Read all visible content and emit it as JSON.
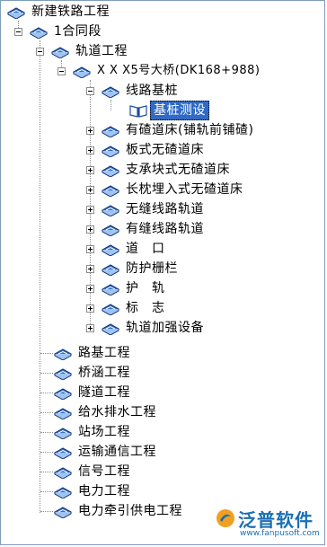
{
  "tree": {
    "root": "新建铁路工程",
    "section": "1合同段",
    "track": "轨道工程",
    "bridge": "X X X5号大桥(DK168+988)",
    "subgrade_pile": "线路基桩",
    "selected_item": "基桩测设",
    "track_children": [
      "有碴道床(铺轨前铺碴)",
      "板式无碴道床",
      "支承块式无碴道床",
      "长枕埋入式无碴道床",
      "无缝线路轨道",
      "有缝线路轨道",
      "道　口",
      "防护栅栏",
      "护　轨",
      "标　志",
      "轨道加强设备"
    ],
    "section_children": [
      "路基工程",
      "桥涵工程",
      "隧道工程",
      "给水排水工程",
      "站场工程",
      "运输通信工程",
      "信号工程",
      "电力工程",
      "电力牵引供电工程"
    ]
  },
  "watermark": {
    "brand": "泛普软件",
    "url": "www.fanpusoft.com"
  },
  "colors": {
    "selection": "#316ac5",
    "book_blue": "#2f6fd0",
    "brand": "#1a6fb3"
  }
}
